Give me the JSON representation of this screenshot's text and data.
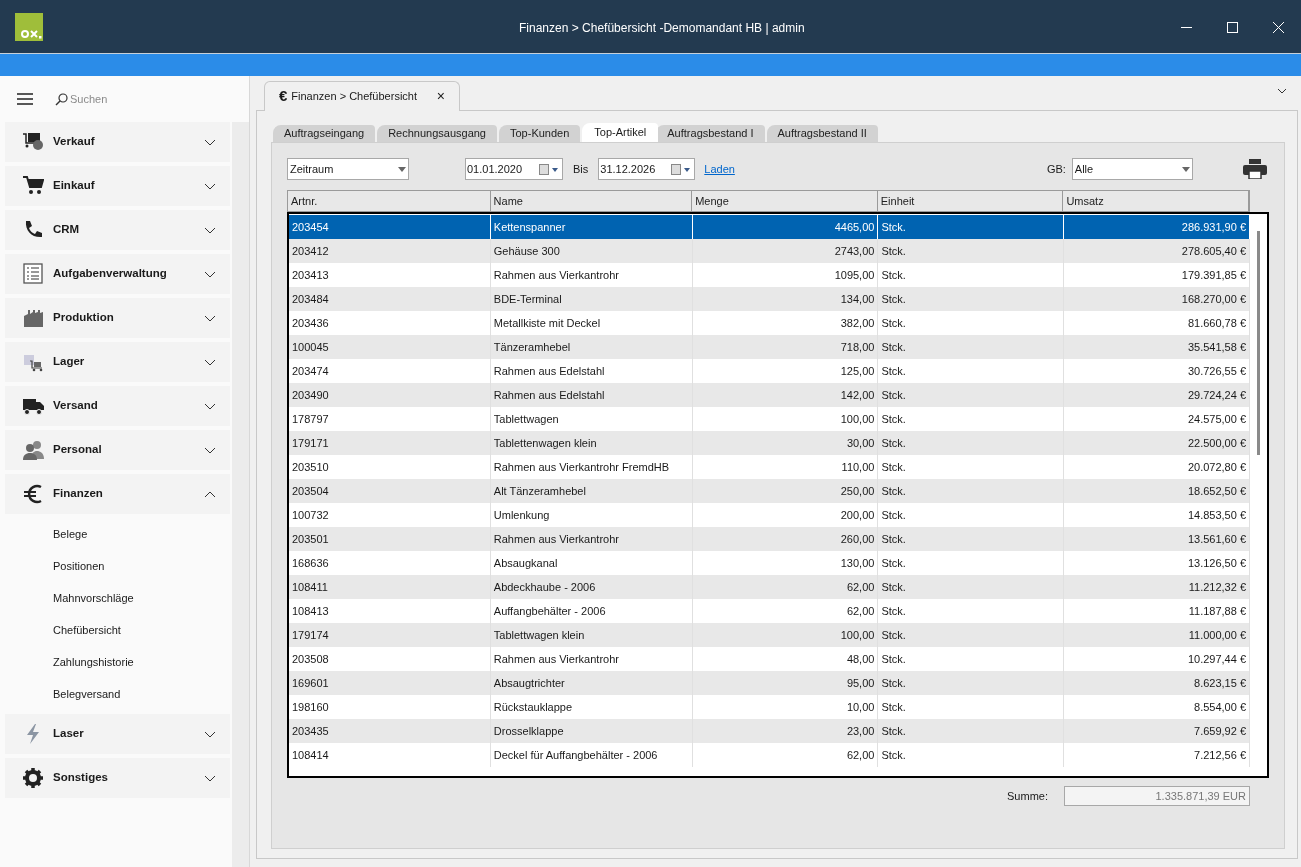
{
  "window": {
    "title": "Finanzen > Chefübersicht -Demomandant HB | admin"
  },
  "sidebar": {
    "search_placeholder": "Suchen",
    "items": [
      {
        "label": "Verkauf",
        "expanded": false
      },
      {
        "label": "Einkauf",
        "expanded": false
      },
      {
        "label": "CRM",
        "expanded": false
      },
      {
        "label": "Aufgabenverwaltung",
        "expanded": false
      },
      {
        "label": "Produktion",
        "expanded": false
      },
      {
        "label": "Lager",
        "expanded": false
      },
      {
        "label": "Versand",
        "expanded": false
      },
      {
        "label": "Personal",
        "expanded": false
      },
      {
        "label": "Finanzen",
        "expanded": true,
        "children": [
          "Belege",
          "Positionen",
          "Mahnvorschläge",
          "Chefübersicht",
          "Zahlungshistorie",
          "Belegversand"
        ]
      },
      {
        "label": "Laser",
        "expanded": false
      },
      {
        "label": "Sonstiges",
        "expanded": false
      }
    ]
  },
  "document_tab": {
    "icon_char": "€",
    "label": "Finanzen > Chefübersicht",
    "close": "×"
  },
  "tabs": [
    {
      "label": "Auftragseingang",
      "selected": false
    },
    {
      "label": "Rechnungsausgang",
      "selected": false
    },
    {
      "label": "Top-Kunden",
      "selected": false
    },
    {
      "label": "Top-Artikel",
      "selected": true
    },
    {
      "label": "Auftragsbestand I",
      "selected": false
    },
    {
      "label": "Auftragsbestand II",
      "selected": false
    }
  ],
  "filter": {
    "period": "Zeitraum",
    "from": "01.01.2020",
    "to_label": "Bis",
    "to": "31.12.2026",
    "load": "Laden",
    "gb_label": "GB:",
    "gb": "Alle"
  },
  "table": {
    "columns": [
      "Artnr.",
      "Name",
      "Menge",
      "Einheit",
      "Umsatz"
    ],
    "rows": [
      {
        "cells": [
          "203454",
          "Kettenspanner",
          "4465,00",
          "Stck.",
          "286.931,90 €"
        ],
        "selected": true
      },
      {
        "cells": [
          "203412",
          "Gehäuse 300",
          "2743,00",
          "Stck.",
          "278.605,40 €"
        ],
        "selected": false
      },
      {
        "cells": [
          "203413",
          "Rahmen aus Vierkantrohr",
          "1095,00",
          "Stck.",
          "179.391,85 €"
        ],
        "selected": false
      },
      {
        "cells": [
          "203484",
          "BDE-Terminal",
          "134,00",
          "Stck.",
          "168.270,00 €"
        ],
        "selected": false
      },
      {
        "cells": [
          "203436",
          "Metallkiste mit Deckel",
          "382,00",
          "Stck.",
          "81.660,78 €"
        ],
        "selected": false
      },
      {
        "cells": [
          "100045",
          "Tänzeramhebel",
          "718,00",
          "Stck.",
          "35.541,58 €"
        ],
        "selected": false
      },
      {
        "cells": [
          "203474",
          "Rahmen aus Edelstahl",
          "125,00",
          "Stck.",
          "30.726,55 €"
        ],
        "selected": false
      },
      {
        "cells": [
          "203490",
          "Rahmen aus Edelstahl",
          "142,00",
          "Stck.",
          "29.724,24 €"
        ],
        "selected": false
      },
      {
        "cells": [
          "178797",
          "Tablettwagen",
          "100,00",
          "Stck.",
          "24.575,00 €"
        ],
        "selected": false
      },
      {
        "cells": [
          "179171",
          "Tablettenwagen klein",
          "30,00",
          "Stck.",
          "22.500,00 €"
        ],
        "selected": false
      },
      {
        "cells": [
          "203510",
          "Rahmen aus Vierkantrohr FremdHB",
          "110,00",
          "Stck.",
          "20.072,80 €"
        ],
        "selected": false
      },
      {
        "cells": [
          "203504",
          "Alt Tänzeramhebel",
          "250,00",
          "Stck.",
          "18.652,50 €"
        ],
        "selected": false
      },
      {
        "cells": [
          "100732",
          "Umlenkung",
          "200,00",
          "Stck.",
          "14.853,50 €"
        ],
        "selected": false
      },
      {
        "cells": [
          "203501",
          "Rahmen aus Vierkantrohr",
          "260,00",
          "Stck.",
          "13.561,60 €"
        ],
        "selected": false
      },
      {
        "cells": [
          "168636",
          "Absaugkanal",
          "130,00",
          "Stck.",
          "13.126,50 €"
        ],
        "selected": false
      },
      {
        "cells": [
          "108411",
          "Abdeckhaube - 2006",
          "62,00",
          "Stck.",
          "11.212,32 €"
        ],
        "selected": false
      },
      {
        "cells": [
          "108413",
          "Auffangbehälter - 2006",
          "62,00",
          "Stck.",
          "11.187,88 €"
        ],
        "selected": false
      },
      {
        "cells": [
          "179174",
          "Tablettwagen klein",
          "100,00",
          "Stck.",
          "11.000,00 €"
        ],
        "selected": false
      },
      {
        "cells": [
          "203508",
          "Rahmen aus Vierkantrohr",
          "48,00",
          "Stck.",
          "10.297,44 €"
        ],
        "selected": false
      },
      {
        "cells": [
          "169601",
          "Absaugtrichter",
          "95,00",
          "Stck.",
          "8.623,15 €"
        ],
        "selected": false
      },
      {
        "cells": [
          "198160",
          "Rückstauklappe",
          "10,00",
          "Stck.",
          "8.554,00 €"
        ],
        "selected": false
      },
      {
        "cells": [
          "203435",
          "Drosselklappe",
          "23,00",
          "Stck.",
          "7.659,92 €"
        ],
        "selected": false
      },
      {
        "cells": [
          "108414",
          "Deckel für Auffangbehälter - 2006",
          "62,00",
          "Stck.",
          "7.212,56 €"
        ],
        "selected": false
      }
    ]
  },
  "total": {
    "label": "Summe:",
    "value": "1.335.871,39 EUR"
  }
}
